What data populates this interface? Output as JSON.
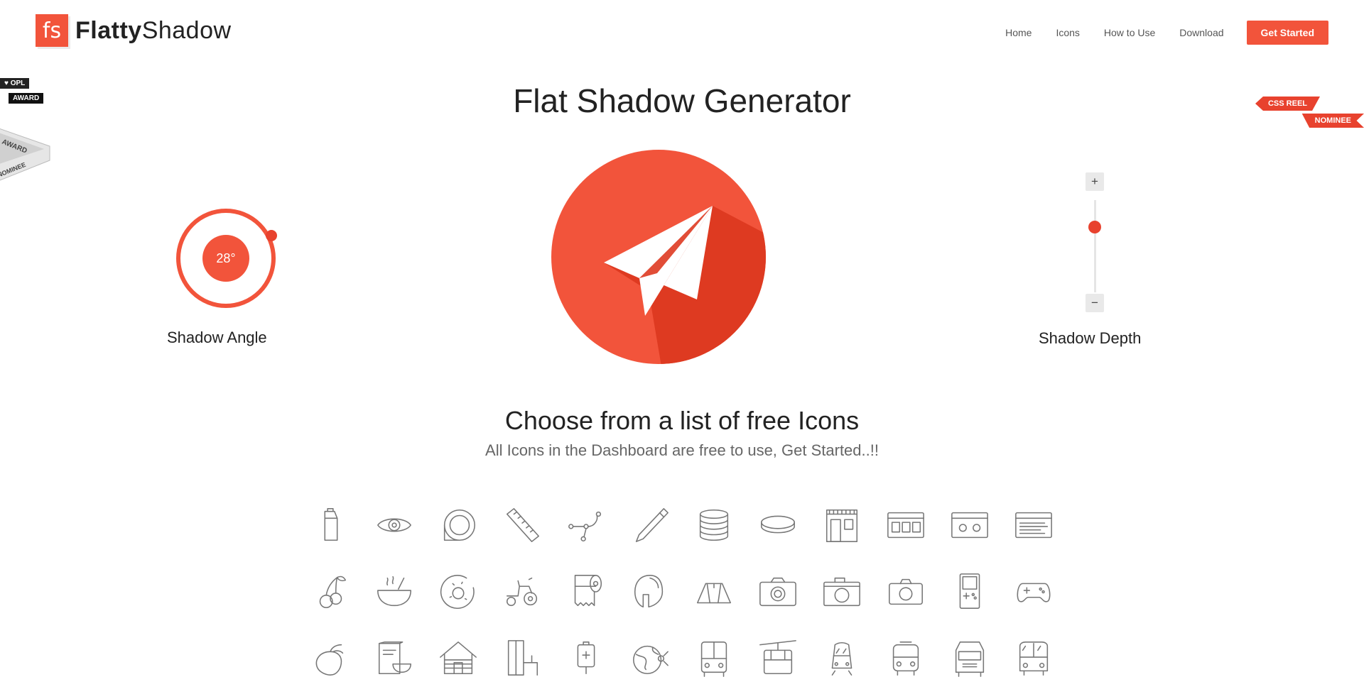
{
  "brand": {
    "mark": "fs",
    "name_bold": "Flatty",
    "name_light": "Shadow"
  },
  "nav": {
    "items": [
      "Home",
      "Icons",
      "How to Use",
      "Download"
    ],
    "cta": "Get Started"
  },
  "badges": {
    "opl": "♥ OPL",
    "opl_award": "AWARD",
    "fwa_award": "AWARD",
    "fwa_nominee": "NOMINEE",
    "css_reel": "CSS REEL",
    "css_nominee": "NOMINEE"
  },
  "title": "Flat Shadow Generator",
  "angle": {
    "value": "28°",
    "label": "Shadow Angle"
  },
  "depth": {
    "plus": "+",
    "minus": "−",
    "label": "Shadow Depth"
  },
  "choose": {
    "heading": "Choose from a list of free Icons",
    "subheading": "All Icons in the Dashboard are free to use, Get Started..!!"
  },
  "icons": [
    "milk-carton-icon",
    "eye-icon",
    "disc-icon",
    "ruler-icon",
    "vector-path-icon",
    "knife-icon",
    "coins-stack-icon",
    "coin-icon",
    "shop-front-icon",
    "browser-grid-icon",
    "browser-cassette-icon",
    "browser-text-icon",
    "cherries-icon",
    "bowl-icon",
    "donut-icon",
    "tractor-icon",
    "toilet-paper-icon",
    "spartan-helmet-icon",
    "tent-icon",
    "camera-icon",
    "camera-alt-icon",
    "camera-compact-icon",
    "gameboy-icon",
    "gamepad-icon",
    "strawberry-icon",
    "cereal-box-icon",
    "cabin-icon",
    "wardrobe-icon",
    "iv-bag-icon",
    "globe-satellite-icon",
    "bus-icon",
    "cable-car-icon",
    "tram-icon",
    "train-icon",
    "truck-icon",
    "van-icon"
  ],
  "colors": {
    "accent": "#f2543b",
    "accent_dark": "#de3a21"
  }
}
